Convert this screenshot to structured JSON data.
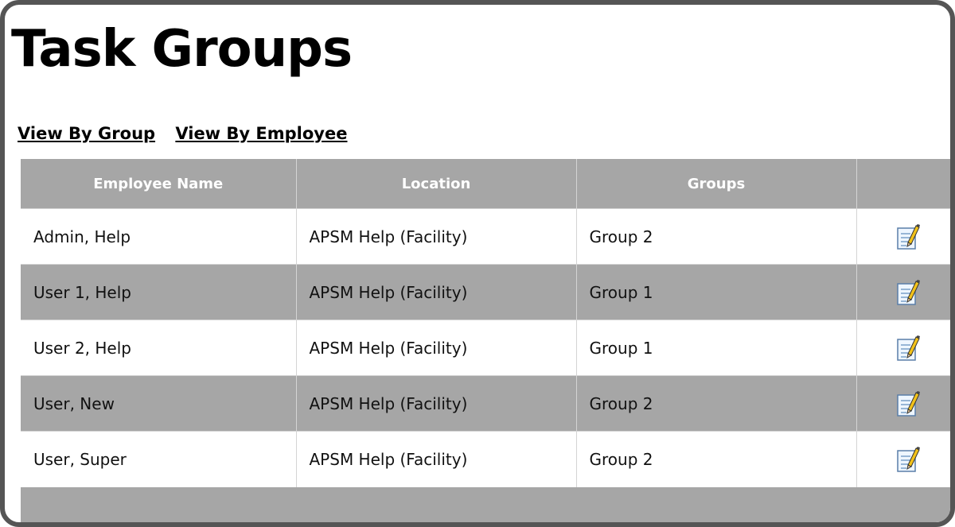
{
  "page": {
    "title": "Task Groups"
  },
  "view_links": [
    "View By Group",
    "View By Employee"
  ],
  "table": {
    "columns": [
      "Employee Name",
      "Location",
      "Groups",
      ""
    ],
    "rows": [
      {
        "employee": "Admin, Help",
        "location": "APSM Help (Facility)",
        "group": "Group 2",
        "action_icon": "edit-icon"
      },
      {
        "employee": "User 1, Help",
        "location": "APSM Help (Facility)",
        "group": "Group 1",
        "action_icon": "edit-icon"
      },
      {
        "employee": "User 2, Help",
        "location": "APSM Help (Facility)",
        "group": "Group 1",
        "action_icon": "edit-icon"
      },
      {
        "employee": "User, New",
        "location": "APSM Help (Facility)",
        "group": "Group 2",
        "action_icon": "edit-icon"
      },
      {
        "employee": "User, Super",
        "location": "APSM Help (Facility)",
        "group": "Group 2",
        "action_icon": "edit-icon"
      }
    ]
  },
  "colors": {
    "header_bg": "#a6a6a6",
    "alt_row_bg": "#a6a6a6",
    "frame_border": "#555555"
  }
}
